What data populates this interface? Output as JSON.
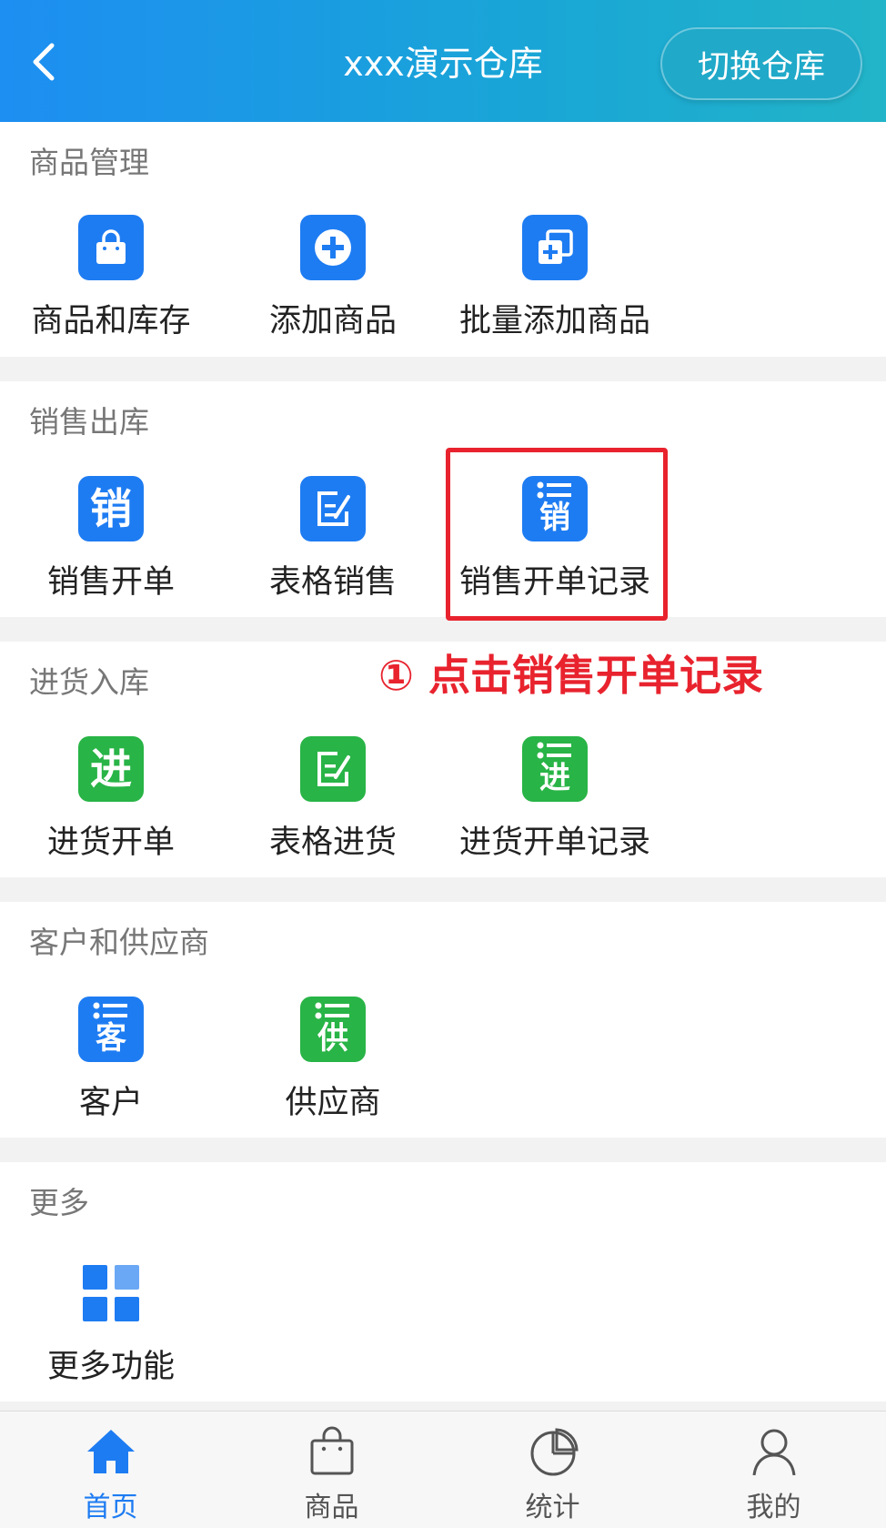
{
  "header": {
    "title": "xxx演示仓库",
    "switch_label": "切换仓库"
  },
  "sections": {
    "goods": {
      "title": "商品管理",
      "items": [
        "商品和库存",
        "添加商品",
        "批量添加商品"
      ]
    },
    "sales": {
      "title": "销售出库",
      "items": [
        "销售开单",
        "表格销售",
        "销售开单记录"
      ],
      "icon_glyphs": [
        "销",
        "销"
      ]
    },
    "purchase": {
      "title": "进货入库",
      "items": [
        "进货开单",
        "表格进货",
        "进货开单记录"
      ],
      "icon_glyphs": [
        "进",
        "进"
      ]
    },
    "partners": {
      "title": "客户和供应商",
      "items": [
        "客户",
        "供应商"
      ],
      "icon_glyphs": [
        "客",
        "供"
      ]
    },
    "more": {
      "title": "更多",
      "items": [
        "更多功能"
      ]
    }
  },
  "annotation": {
    "text": "① 点击销售开单记录"
  },
  "tabbar": {
    "tabs": [
      "首页",
      "商品",
      "统计",
      "我的"
    ],
    "active": 0
  },
  "colors": {
    "accent": "#1e7cf2",
    "green": "#28b446",
    "highlight": "#e8232e"
  },
  "icons": {
    "header": [
      "back-icon"
    ],
    "goods": [
      "shopping-bag-icon",
      "plus-circle-icon",
      "batch-add-icon"
    ],
    "sales": [
      "sale-glyph-icon",
      "form-edit-icon",
      "sale-list-icon"
    ],
    "purchase": [
      "purchase-glyph-icon",
      "form-edit-icon",
      "purchase-list-icon"
    ],
    "partners": [
      "customer-list-icon",
      "supplier-list-icon"
    ],
    "more": [
      "grid-icon"
    ],
    "tabbar": [
      "home-icon",
      "bag-icon",
      "pie-chart-icon",
      "user-icon"
    ]
  }
}
